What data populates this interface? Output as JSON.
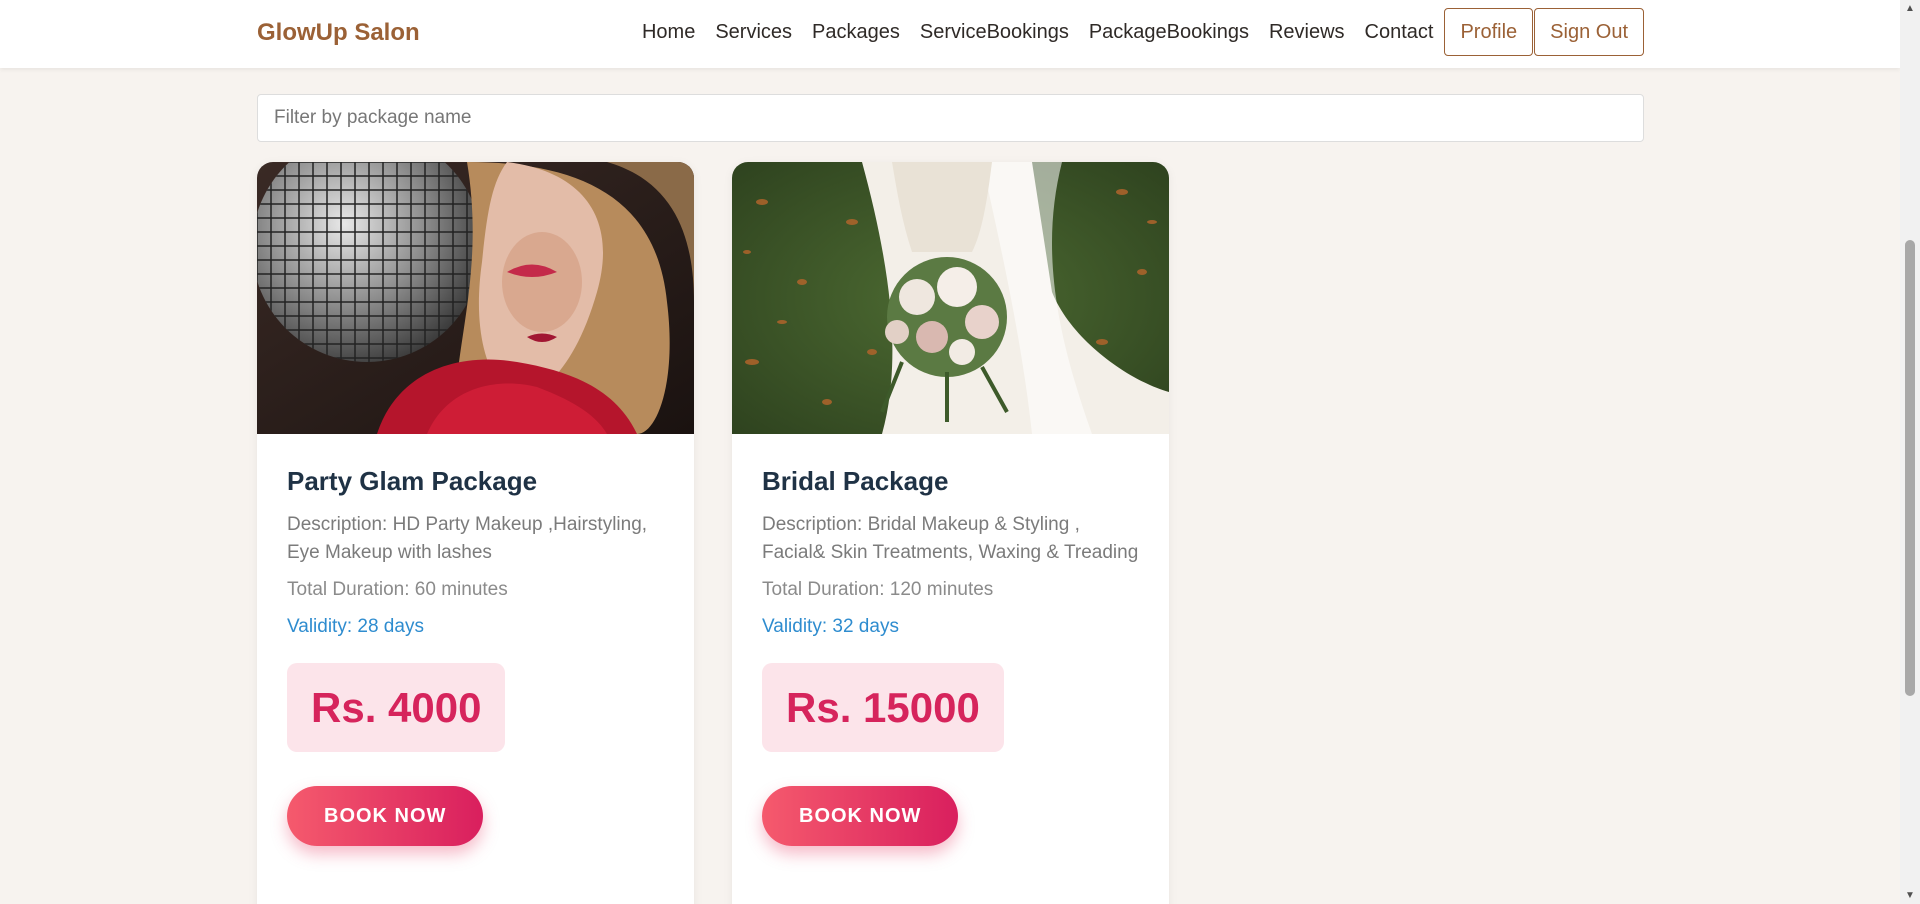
{
  "nav": {
    "brand": "GlowUp Salon",
    "links": [
      "Home",
      "Services",
      "Packages",
      "ServiceBookings",
      "PackageBookings",
      "Reviews",
      "Contact"
    ],
    "profile": "Profile",
    "signout": "Sign Out"
  },
  "filter": {
    "placeholder": "Filter by package name",
    "value": ""
  },
  "packages": [
    {
      "title": "Party Glam Package",
      "description": "Description: HD Party Makeup ,Hairstyling, Eye Makeup with lashes",
      "duration": "Total Duration: 60 minutes",
      "validity": "Validity: 28 days",
      "price": "Rs. 4000",
      "button": "BOOK NOW"
    },
    {
      "title": "Bridal Package",
      "description": "Description: Bridal Makeup & Styling , Facial& Skin Treatments, Waxing & Treading",
      "duration": "Total Duration: 120 minutes",
      "validity": "Validity: 32 days",
      "price": "Rs. 15000",
      "button": "BOOK NOW"
    }
  ],
  "colors": {
    "brand": "#9b6136",
    "price": "#d6245c",
    "validity": "#2e8ccf",
    "title": "#1f3245"
  }
}
